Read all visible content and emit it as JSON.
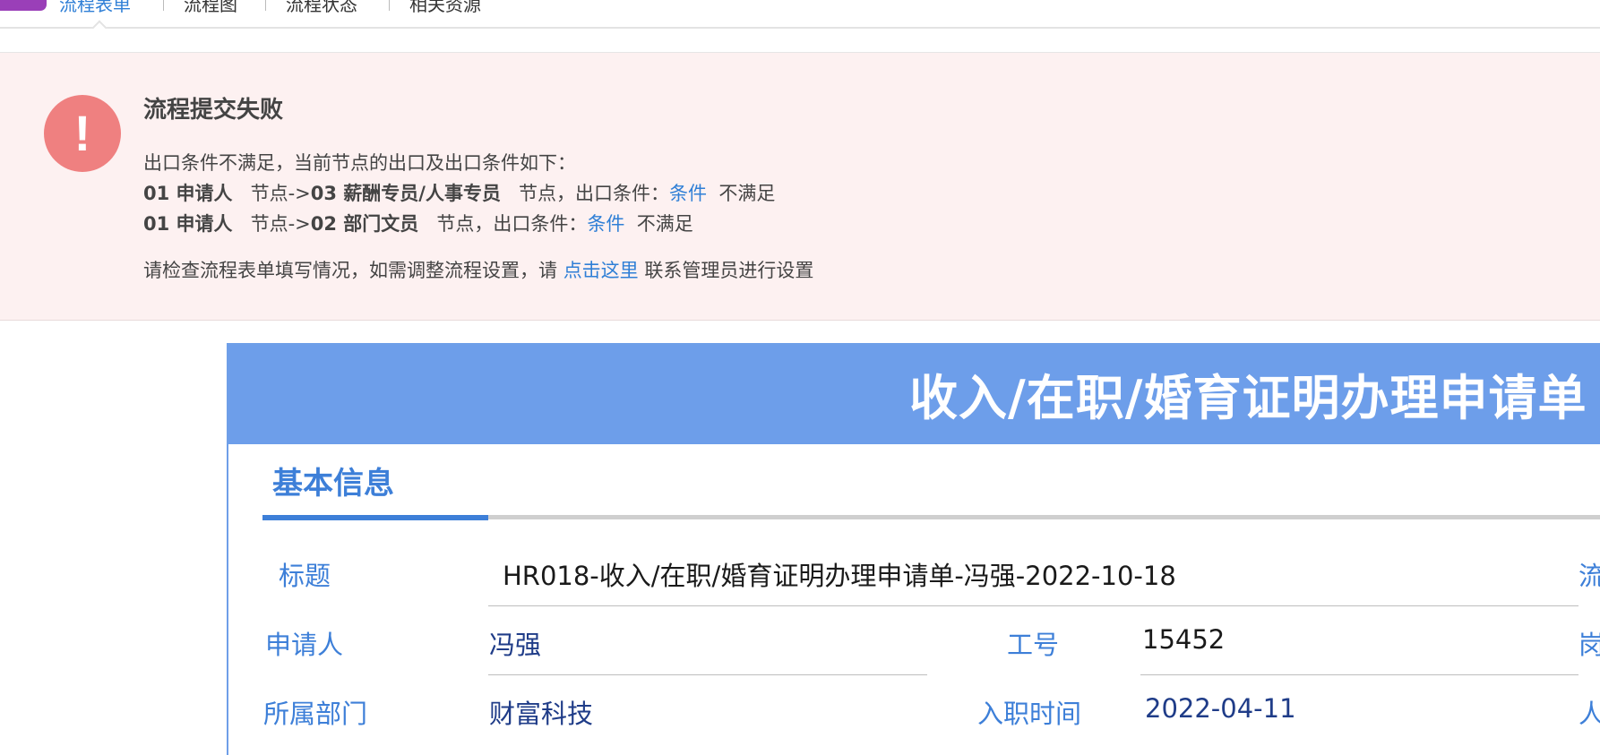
{
  "tabs": [
    {
      "label": "流程表单",
      "active": true
    },
    {
      "label": "流程图",
      "active": false
    },
    {
      "label": "流程状态",
      "active": false
    },
    {
      "label": "相关资源",
      "active": false
    }
  ],
  "error": {
    "title": "流程提交失败",
    "intro": "出口条件不满足，当前节点的出口及出口条件如下：",
    "rows": [
      {
        "from": "01 申请人",
        "mid": "节点->",
        "to": "03 薪酬专员/人事专员",
        "after": "节点，出口条件：",
        "link": "条件",
        "result": "不满足"
      },
      {
        "from": "01 申请人",
        "mid": "节点->",
        "to": "02 部门文员",
        "after": "节点，出口条件：",
        "link": "条件",
        "result": "不满足"
      }
    ],
    "hint_before": "请检查流程表单填写情况，如需调整流程设置，请",
    "hint_link": "点击这里",
    "hint_after": "联系管理员进行设置",
    "icon": "exclamation-icon",
    "color": "#ef8080"
  },
  "form": {
    "title": "收入/在职/婚育证明办理申请单",
    "section": "基本信息",
    "fields": {
      "subject_label": "标题",
      "subject_value": "HR018-收入/在职/婚育证明办理申请单-冯强-2022-10-18",
      "applicant_label": "申请人",
      "applicant_value": "冯强",
      "empno_label": "工号",
      "empno_value": "15452",
      "dept_label": "所属部门",
      "dept_value": "财富科技",
      "hire_label": "入职时间",
      "hire_value": "2022-04-11",
      "right_col_1": "流",
      "right_col_2": "岗",
      "right_col_3": "人"
    }
  },
  "colors": {
    "accent": "#3d7fd8",
    "header_bg": "#6d9eea",
    "error_bg": "#fdf1f1"
  }
}
